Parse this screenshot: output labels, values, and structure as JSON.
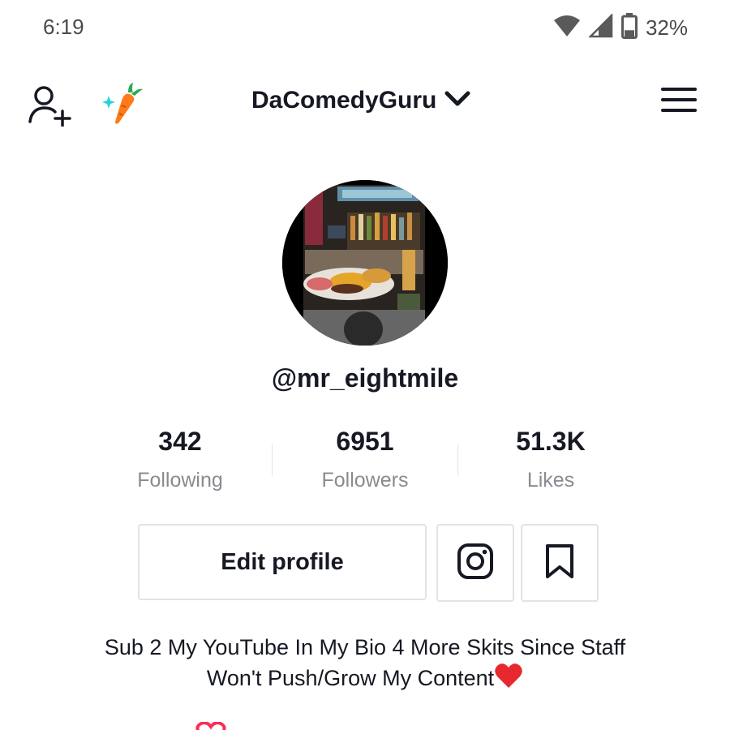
{
  "status_bar": {
    "time": "6:19",
    "battery_percent": "32%",
    "battery_level": 0.32,
    "icons": [
      "wifi-icon",
      "cell-signal-icon",
      "battery-icon"
    ]
  },
  "header": {
    "account_name": "DaComedyGuru",
    "icons": [
      "add-friend-icon",
      "carrot-sparkle-icon",
      "chevron-down-icon",
      "hamburger-menu-icon"
    ]
  },
  "profile": {
    "username": "@mr_eightmile",
    "avatar_icon": "profile-photo"
  },
  "stats": [
    {
      "value": "342",
      "label": "Following"
    },
    {
      "value": "6951",
      "label": "Followers"
    },
    {
      "value": "51.3K",
      "label": "Likes"
    }
  ],
  "actions": {
    "edit_profile_label": "Edit profile",
    "icons": [
      "instagram-icon",
      "bookmark-icon"
    ]
  },
  "bio": {
    "line1": "Sub 2 My YouTube In My Bio 4 More Skits Since Staff",
    "line2": "Won't Push/Grow My Content",
    "emoji": "red-heart-icon"
  },
  "colors": {
    "text_primary": "#161823",
    "text_secondary": "#8a8b91",
    "border": "#e3e3e4",
    "accent": "#fe2c55"
  }
}
